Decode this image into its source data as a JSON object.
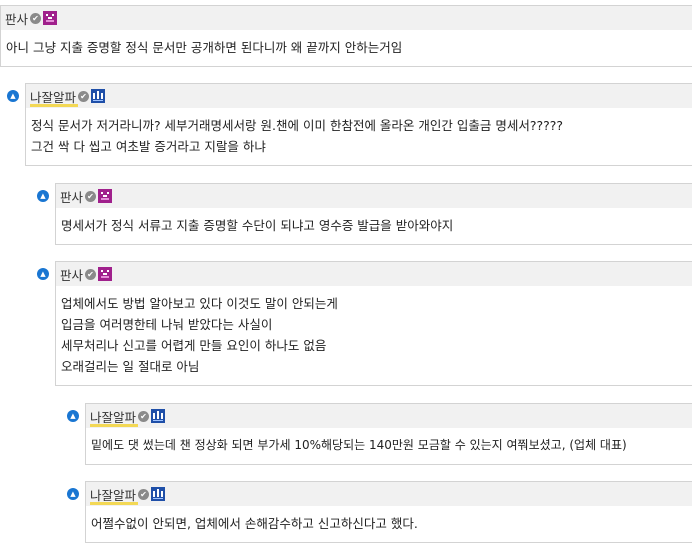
{
  "comments": [
    {
      "author": "판사",
      "badge": "purple-pixel-badge",
      "lines": [
        "아니 그냥 지출 증명할 정식 문서만 공개하면 된다니까 왜 끝까지 안하는거임"
      ]
    },
    {
      "author": "나잘알파",
      "badge": "blue-pixel-badge",
      "lines": [
        "정식 문서가 저거라니까? 세부거래명세서랑 원.챈에 이미 한참전에 올라온 개인간 입출금 명세서?????",
        "그건 싹 다 씹고 여초발 증거라고 지랄을 하냐"
      ]
    },
    {
      "author": "판사",
      "badge": "purple-pixel-badge",
      "lines": [
        "명세서가 정식 서류고 지출 증명할 수단이 되냐고 영수증 발급을 받아와야지"
      ]
    },
    {
      "author": "판사",
      "badge": "purple-pixel-badge",
      "lines": [
        "업체에서도 방법 알아보고 있다 이것도 말이 안되는게",
        "입금을 여러명한테 나눠 받았다는 사실이",
        "세무처리나 신고를 어렵게 만들 요인이 하나도 없음",
        "오래걸리는 일 절대로 아님"
      ]
    },
    {
      "author": "나잘알파",
      "badge": "blue-pixel-badge",
      "lines": [
        "밑에도 댓 썼는데 챈 정상화 되면 부가세 10%해당되는 140만원 모금할 수 있는지 여쭤보셨고, (업체 대표)"
      ]
    },
    {
      "author": "나잘알파",
      "badge": "blue-pixel-badge",
      "lines": [
        "어쩔수없이 안되면, 업체에서 손해감수하고 신고하신다고 했다."
      ]
    }
  ],
  "colors": {
    "collapse_button": "#1976d2",
    "author_highlight": "#f3d33a",
    "header_bg": "#f1f1f1",
    "purple_badge": "#a0208c",
    "blue_badge": "#1f4fa8"
  }
}
